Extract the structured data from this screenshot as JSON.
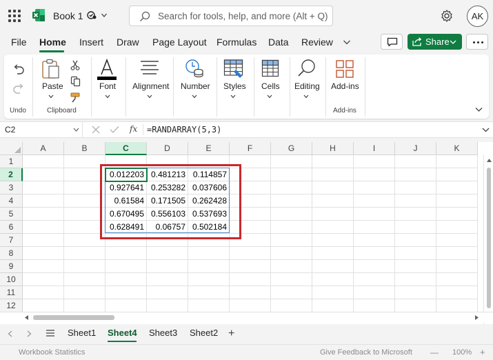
{
  "app": {
    "book_name": "Book 1",
    "user_initials": "AK"
  },
  "search": {
    "placeholder": "Search for tools, help, and more (Alt + Q)"
  },
  "tabs": [
    "File",
    "Home",
    "Insert",
    "Draw",
    "Page Layout",
    "Formulas",
    "Data",
    "Review"
  ],
  "active_tab": "Home",
  "share_label": "Share",
  "ribbon": {
    "undo_group": "Undo",
    "paste": "Paste",
    "clipboard_group": "Clipboard",
    "font": "Font",
    "alignment": "Alignment",
    "number": "Number",
    "styles": "Styles",
    "cells": "Cells",
    "editing": "Editing",
    "addins": "Add-ins",
    "addins_group": "Add-ins"
  },
  "formula_bar": {
    "name_box": "C2",
    "fx": "fx",
    "formula": "=RANDARRAY(5,3)"
  },
  "columns": [
    "A",
    "B",
    "C",
    "D",
    "E",
    "F",
    "G",
    "H",
    "I",
    "J",
    "K"
  ],
  "selected_column": "C",
  "rows": [
    "1",
    "2",
    "3",
    "4",
    "5",
    "6",
    "7",
    "8",
    "9",
    "10",
    "11",
    "12"
  ],
  "selected_row": "2",
  "cell_values": [
    [
      "0.012203",
      "0.481213",
      "0.114857"
    ],
    [
      "0.927641",
      "0.253282",
      "0.037606"
    ],
    [
      "0.61584",
      "0.171505",
      "0.262428"
    ],
    [
      "0.670495",
      "0.556103",
      "0.537693"
    ],
    [
      "0.628491",
      "0.06757",
      "0.502184"
    ]
  ],
  "sheets": [
    "Sheet1",
    "Sheet4",
    "Sheet3",
    "Sheet2"
  ],
  "active_sheet": "Sheet4",
  "status": {
    "left": "Workbook Statistics",
    "feedback": "Give Feedback to Microsoft",
    "minus": "—",
    "zoom": "100%",
    "plus": "+"
  },
  "colors": {
    "accent": "#107c41",
    "highlight_box": "#c8282d",
    "spill_border": "#4a86c5"
  }
}
